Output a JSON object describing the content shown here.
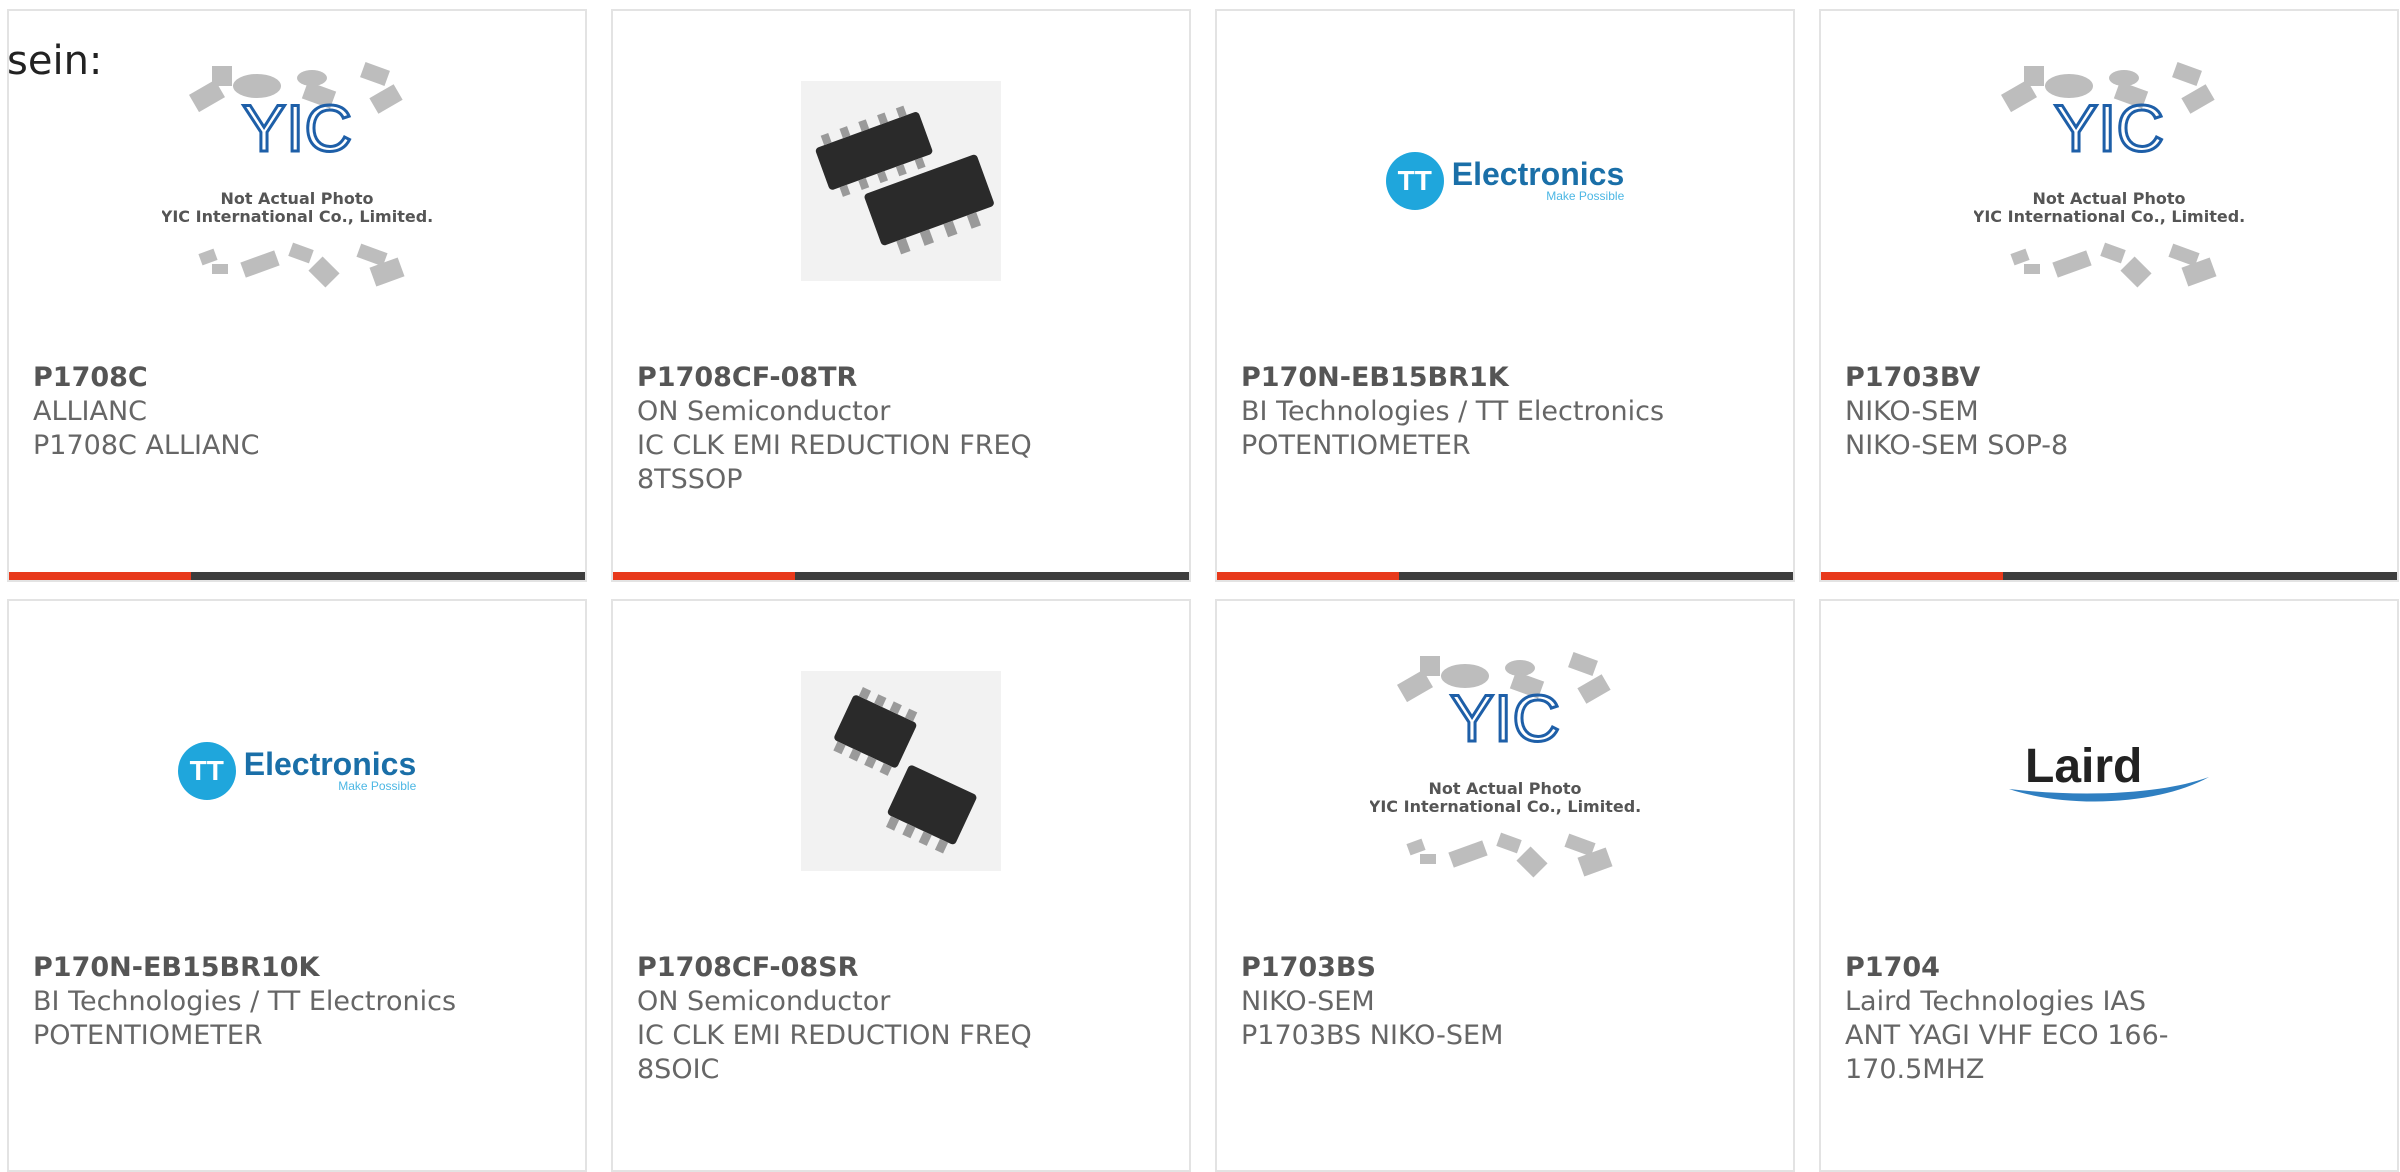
{
  "lead_text": "sein:",
  "brand_colors": {
    "accent": "#e8391b",
    "bar": "#3d3d3d",
    "tt_blue": "#1fa6dc",
    "yic_blue": "#1e5fa8"
  },
  "products": [
    {
      "part": "P1708C",
      "manufacturer": "ALLIANC",
      "description": "P1708C ALLIANC",
      "image": "yic-placeholder",
      "image_text": {
        "line1": "Not Actual Photo",
        "line2": "YIC International Co., Limited."
      }
    },
    {
      "part": "P1708CF-08TR",
      "manufacturer": "ON Semiconductor",
      "description": "IC CLK EMI REDUCTION FREQ 8TSSOP",
      "image": "chip-photo-tssop"
    },
    {
      "part": "P170N-EB15BR1K",
      "manufacturer": "BI Technologies / TT Electronics",
      "description": "POTENTIOMETER",
      "image": "tt-electronics-logo",
      "image_text": {
        "mark": "TT",
        "word": "Electronics",
        "tagline": "Make Possible"
      }
    },
    {
      "part": "P1703BV",
      "manufacturer": "NIKO-SEM",
      "description": "NIKO-SEM SOP-8",
      "image": "yic-placeholder",
      "image_text": {
        "line1": "Not Actual Photo",
        "line2": "YIC International Co., Limited."
      }
    },
    {
      "part": "P170N-EB15BR10K",
      "manufacturer": "BI Technologies / TT Electronics",
      "description": "POTENTIOMETER",
      "image": "tt-electronics-logo",
      "image_text": {
        "mark": "TT",
        "word": "Electronics",
        "tagline": "Make Possible"
      }
    },
    {
      "part": "P1708CF-08SR",
      "manufacturer": "ON Semiconductor",
      "description": "IC CLK EMI REDUCTION FREQ 8SOIC",
      "image": "chip-photo-soic"
    },
    {
      "part": "P1703BS",
      "manufacturer": "NIKO-SEM",
      "description": "P1703BS NIKO-SEM",
      "image": "yic-placeholder",
      "image_text": {
        "line1": "Not Actual Photo",
        "line2": "YIC International Co., Limited."
      }
    },
    {
      "part": "P1704",
      "manufacturer": "Laird Technologies IAS",
      "description": "ANT YAGI VHF ECO 166-170.5MHZ",
      "image": "laird-logo",
      "image_text": {
        "word": "Laird"
      }
    }
  ]
}
